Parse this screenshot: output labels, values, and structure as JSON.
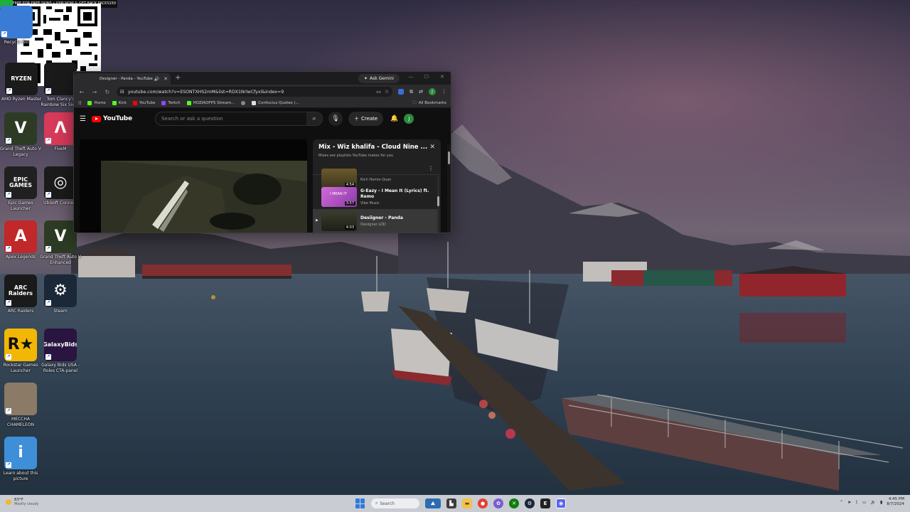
{
  "qr_overlay": {
    "banner_text": "PLAY FREE FOR FREE SKINS • JOIN NOW & GET BACK PACKS",
    "counter": "150"
  },
  "desktop_icons": [
    {
      "label": "Recycle Bin",
      "glyph": "",
      "color": "#3a7bd5",
      "icon": "recycle-bin-icon"
    },
    {
      "label": "AMD Ryzen Master",
      "glyph": "RYZEN",
      "color": "#1b1b1b",
      "icon": "amd-ryzen-master-icon"
    },
    {
      "label": "Tom Clancy's Rainbow Six Siege",
      "glyph": "",
      "color": "#1a1a1a",
      "icon": "rainbow-six-siege-icon"
    },
    {
      "label": "Grand Theft Auto V Legacy",
      "glyph": "V",
      "color": "#2d3b24",
      "icon": "gta-v-legacy-icon"
    },
    {
      "label": "FiveM",
      "glyph": "Λ",
      "color": "#d83a5a",
      "icon": "fivem-icon"
    },
    {
      "label": "Epic Games Launcher",
      "glyph": "EPIC GAMES",
      "color": "#202020",
      "icon": "epic-games-icon"
    },
    {
      "label": "Ubisoft Connect",
      "glyph": "◎",
      "color": "#1b1b1b",
      "icon": "ubisoft-connect-icon"
    },
    {
      "label": "Apex Legends",
      "glyph": "A",
      "color": "#c0282a",
      "icon": "apex-legends-icon"
    },
    {
      "label": "Grand Theft Auto V Enhanced",
      "glyph": "V",
      "color": "#2d3b24",
      "icon": "gta-v-enhanced-icon"
    },
    {
      "label": "ARC Raiders",
      "glyph": "ARC Raiders",
      "color": "#1a1a1a",
      "icon": "arc-raiders-icon"
    },
    {
      "label": "Steam",
      "glyph": "⚙",
      "color": "#1b2838",
      "icon": "steam-icon"
    },
    {
      "label": "Rockstar Games Launcher",
      "glyph": "R★",
      "color": "#f2b705",
      "icon": "rockstar-launcher-icon"
    },
    {
      "label": "Galaxy Bids USA - Roles CTA-panel",
      "glyph": "GalaxyBids",
      "color": "#2a1440",
      "icon": "galaxy-bids-icon"
    },
    {
      "label": "MECCHA CHAMELEON",
      "glyph": "",
      "color": "#8a7a66",
      "icon": "meccha-chameleon-icon"
    },
    {
      "label": "Learn about this picture",
      "glyph": "i",
      "color": "#3f8fd8",
      "icon": "learn-about-picture-icon"
    }
  ],
  "browser": {
    "tab_title": "Designer - Panda - YouTube",
    "ask_gemini": "Ask Gemini",
    "url": "youtube.com/watch?v=ESONTXHS2mM&list=RDX1NrlwCfyxl&index=9",
    "bookmarks": [
      "Home",
      "Kick",
      "YouTube",
      "Twitch",
      "HOZIAOFPS Stream...",
      "",
      "Confucius Quotes (..."
    ],
    "all_bookmarks": "All Bookmarks"
  },
  "youtube": {
    "logo_text": "YouTube",
    "search_placeholder": "Search or ask a question",
    "create_label": "Create",
    "avatar_letter": "J",
    "playlist": {
      "title": "Mix - Wiz khalifa - Cloud Nine ...",
      "subtitle": "Mixes are playlists YouTube makes for you",
      "items": [
        {
          "title": "",
          "channel": "Rich Homie Quan",
          "duration": "4:54"
        },
        {
          "title": "G-Eazy - I Mean It (Lyrics) ft. Remo",
          "channel": "Vibe Music",
          "duration": "3:57"
        },
        {
          "title": "Desiigner - Panda",
          "channel": "Desiigner LOD",
          "duration": "4:03"
        }
      ]
    }
  },
  "taskbar": {
    "weather_temp": "83°F",
    "weather_desc": "Mostly cloudy",
    "search_label": "Search",
    "time": "4:45 PM",
    "date": "8/7/2024"
  },
  "colors": {
    "yt_red": "#ff0000",
    "accent_blue": "#2f7bd8"
  }
}
